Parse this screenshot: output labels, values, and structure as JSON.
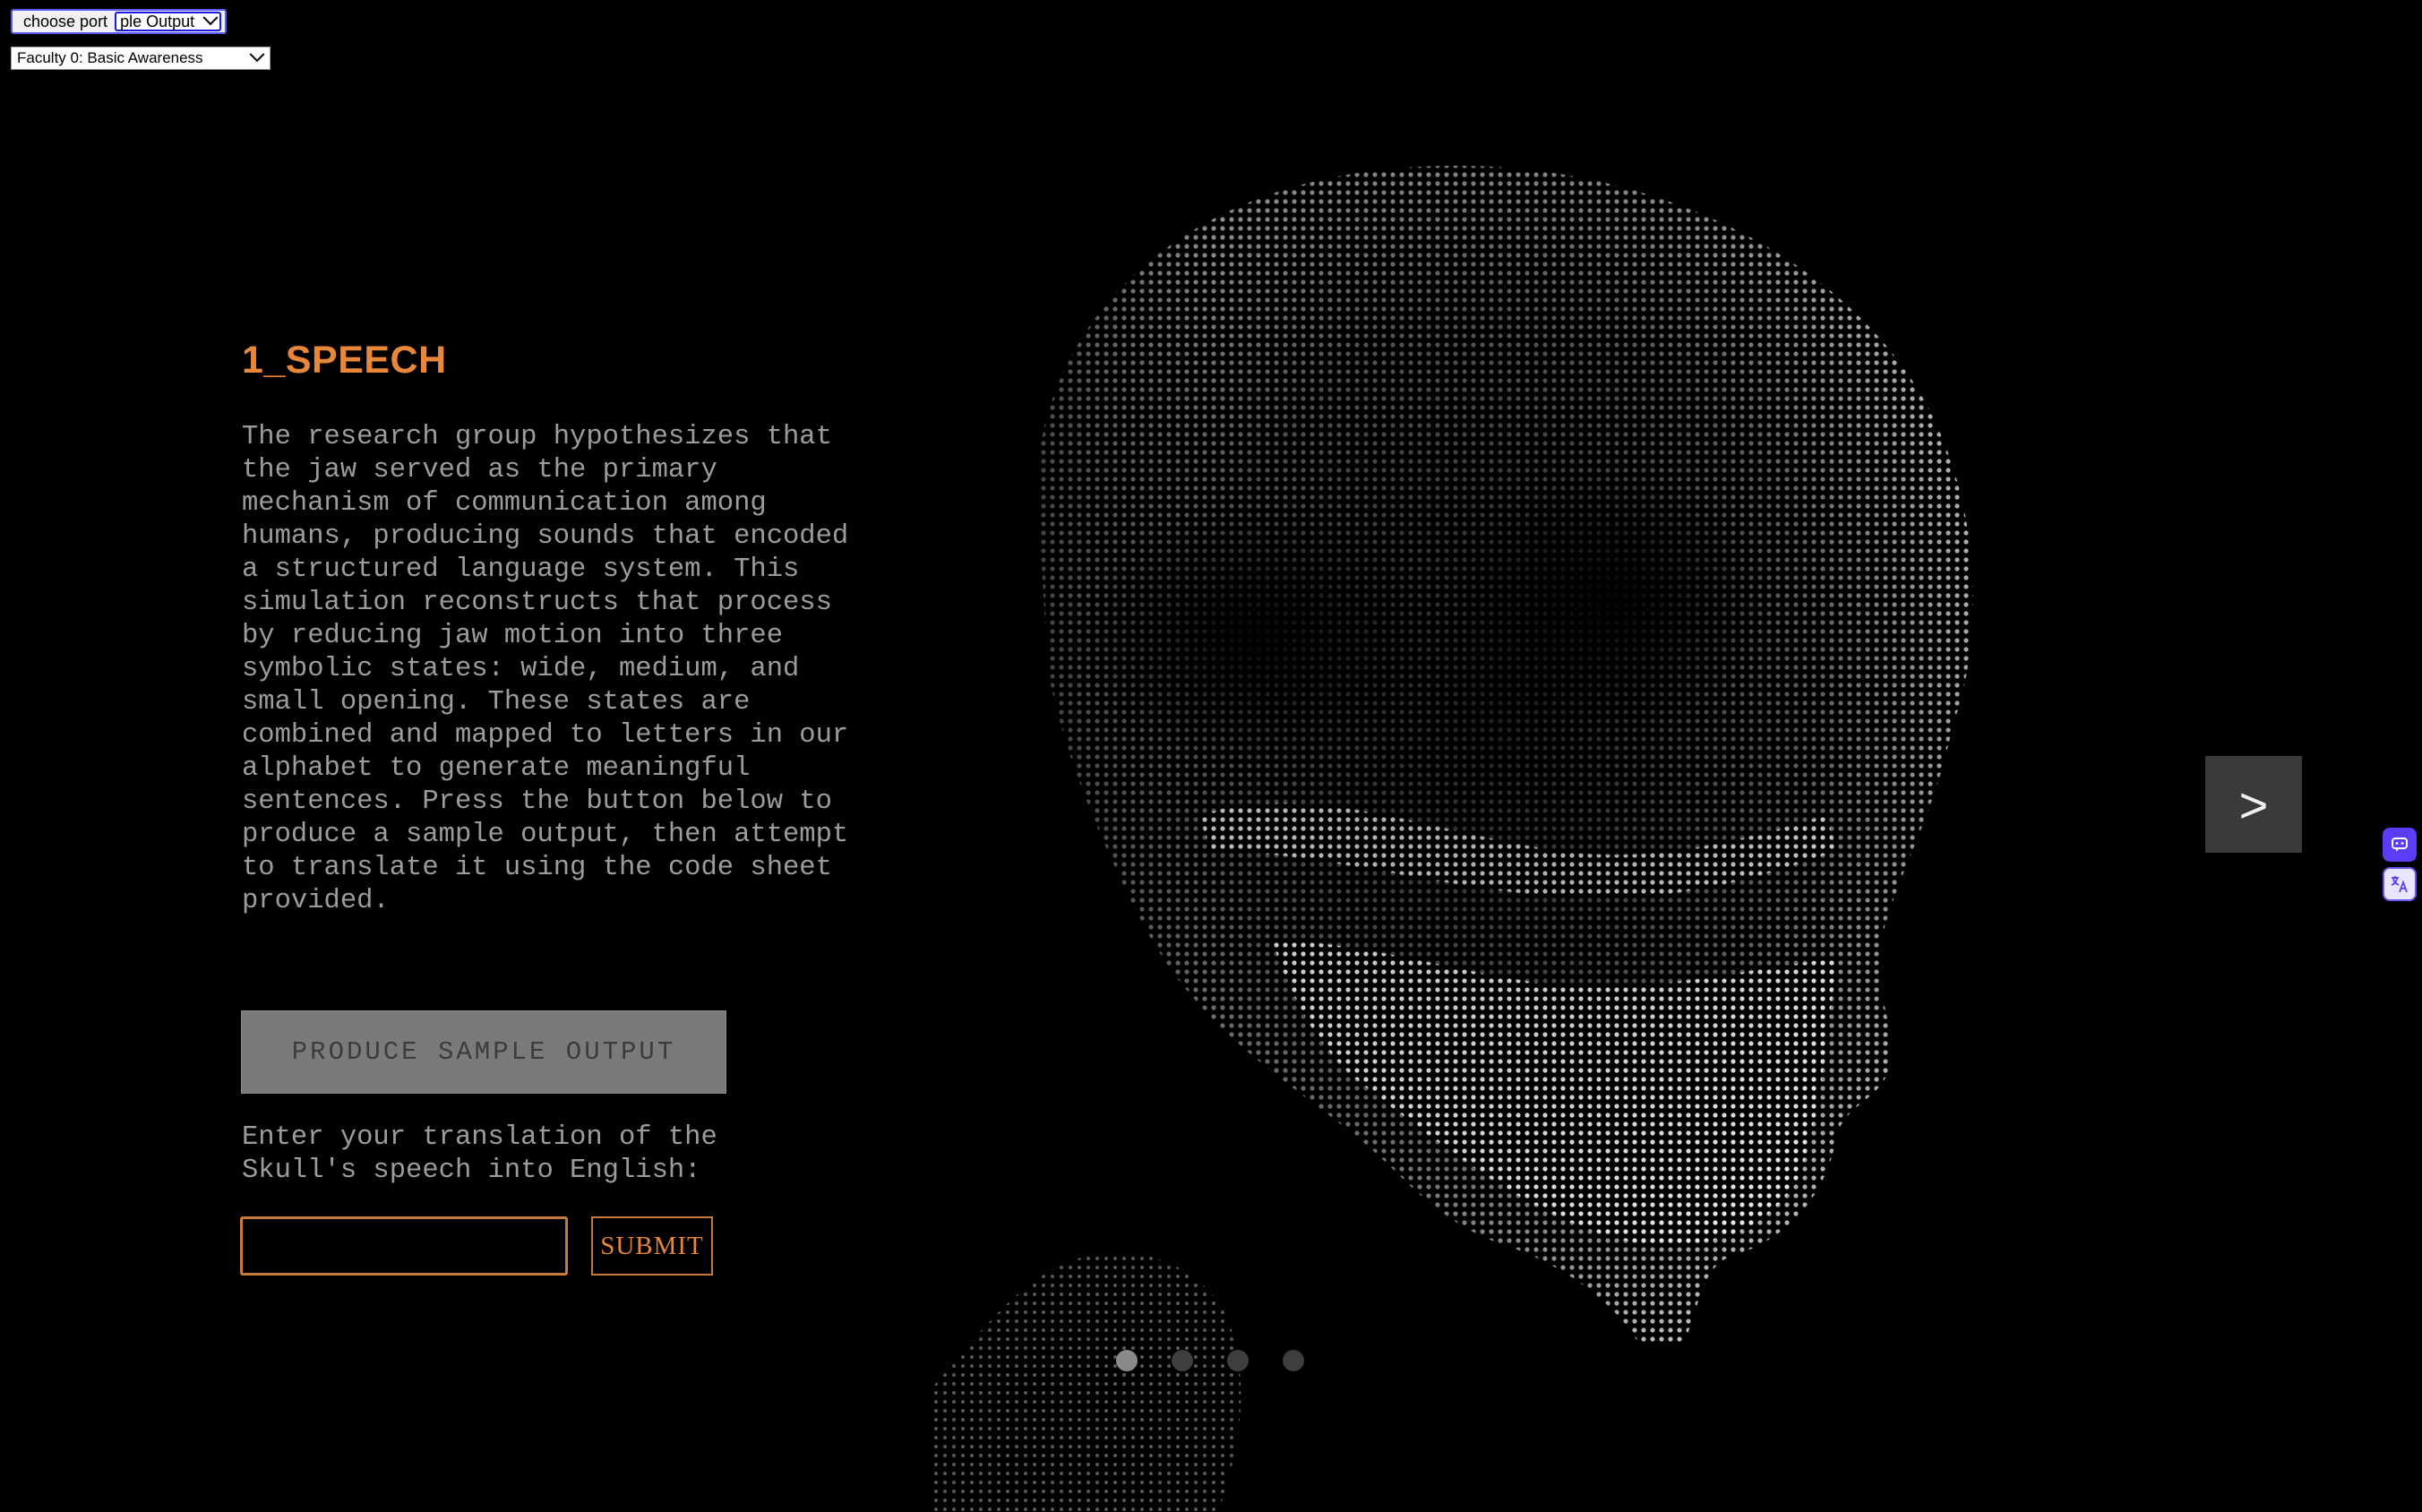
{
  "port_bar": {
    "button_label": "choose port",
    "selected_port": "ple Output"
  },
  "faculty": {
    "selected": "Faculty 0: Basic Awareness"
  },
  "section": {
    "title": "1_SPEECH",
    "description": "The research group hypothesizes that the jaw served as the primary mechanism of communication among humans, producing sounds that encoded a structured language system. This simulation reconstructs that process by reducing jaw motion into three symbolic states: wide, medium, and small opening. These states are combined and mapped to letters in our alphabet to generate meaningful sentences. Press the button below to produce a sample output, then attempt to translate it using the code sheet provided."
  },
  "actions": {
    "produce_label": "PRODUCE SAMPLE OUTPUT",
    "prompt": "Enter your translation of the Skull's speech into English:",
    "input_value": "",
    "submit_label": "SUBMIT"
  },
  "navigation": {
    "next_label": ">",
    "dots": [
      {
        "active": true
      },
      {
        "active": false
      },
      {
        "active": false
      },
      {
        "active": false
      }
    ]
  },
  "colors": {
    "accent": "#e8873a",
    "body_text": "#9c9c9c",
    "background": "#000000"
  }
}
